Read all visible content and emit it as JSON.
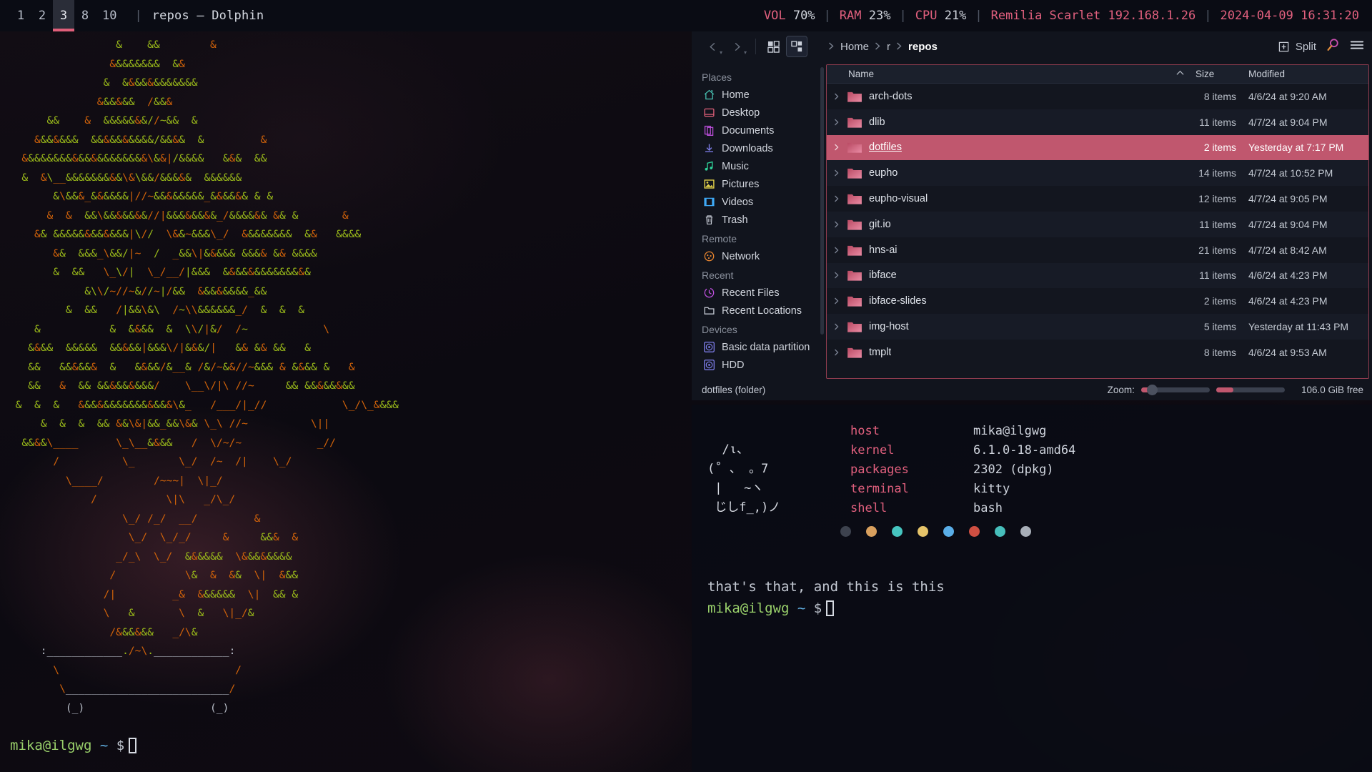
{
  "topbar": {
    "tags": [
      {
        "label": "1",
        "active": false
      },
      {
        "label": "2",
        "active": false
      },
      {
        "label": "3",
        "active": true
      },
      {
        "label": "8",
        "active": false
      },
      {
        "label": "10",
        "active": false
      }
    ],
    "separator": "|",
    "window_title": "repos — Dolphin",
    "status": {
      "vol_label": "VOL",
      "vol_value": "70%",
      "ram_label": "RAM",
      "ram_value": "23%",
      "cpu_label": "CPU",
      "cpu_value": "21%",
      "host_label": "Remilia Scarlet",
      "host_ip": "192.168.1.26",
      "datetime": "2024-04-09 16:31:20",
      "pipe": "|"
    },
    "accent": "#e05f7a"
  },
  "left_terminal": {
    "prompt_user": "mika@ilgwg",
    "prompt_path": "~",
    "prompt_symbol": "$",
    "ascii_art": [
      "                  &    &&        &",
      "                 &&&&&&&&  &&",
      "                &  &&&&&&&&&&&&",
      "               &&&&&&  /&&&",
      "       &&    &  &&&&&&&//~&&  &",
      "     &&&&&&&  &&&&&&&&&&/&&&&  &         &",
      "   &&&&&&&&&&&&&&&&&&&&\\&&|/&&&&   &&&  &&",
      "   &  &\\__&&&&&&&&&\\&\\&&/&&&&&  &&&&&&",
      "        &\\&&&_&&&&&&|//~&&&&&&&&_&&&&&& & &",
      "       &  &  &&\\&&&&&&&//|&&&&&&&&_/&&&&&& && &       &",
      "     && &&&&&&&&&&&&|\\//  \\&&~&&&\\_/  &&&&&&&&  &&   &&&&",
      "        &&  &&&_\\&&/|~  /  _&&\\|&&&&& &&&& && &&&&",
      "        &  &&   \\_\\/|  \\_/__/|&&&  &&&&&&&&&&&&&&",
      "             &\\\\/~//~&//~|/&&  &&&&&&&&_&&",
      "          &  &&   /|&&\\&\\  /~\\\\&&&&&&_/  &  &  &",
      "     &           &  &&&&  &  \\\\/|&/  /~            \\",
      "    &&&&  &&&&&  &&&&&|&&&\\/|&&&/|   && && &&   &",
      "    &&   &&&&&&  &   &&&&/&__& /&/~&&//~&&& & &&&& &   &",
      "    &&   &  && &&&&&&&&&/    \\__\\/|\\ //~     && &&&&&&&&",
      "  &  &  &   &&&&&&&&&&&&&&&\\&_   /___/|_//            \\_/\\_&&&&",
      "      &  &  &  && &&\\&|&&_&&\\&& \\_\\ //~          \\||",
      "   &&&&\\____      \\_\\__&&&&   /  \\/~/~            _//",
      "        /          \\_       \\_/  /~  /|    \\_/",
      "          \\____/        /~~~|  \\|_/",
      "              /           \\|\\   _/\\_/",
      "                   \\_/ /_/  __/         &",
      "                    \\_/  \\_/_/     &     &&&  &",
      "                  _/_\\  \\_/  &&&&&&  \\&&&&&&&&",
      "                 /           \\&  &  &&  \\|  &&&",
      "                /|         _&  &&&&&&  \\|  && &",
      "                \\   &       \\  &   \\|_/&",
      "                 /&&&&&&   _/\\&",
      "      :____________./~\\.____________:",
      "        \\                            /",
      "         \\__________________________/",
      "          (_)                    (_)"
    ]
  },
  "dolphin": {
    "toolbar": {
      "back_icon": "chevron-left-icon",
      "forward_icon": "chevron-right-icon",
      "view_icons_label": "icons-view",
      "view_details_label": "details-view",
      "split_label": "Split",
      "search_icon": "search-icon",
      "menu_icon": "hamburger-menu-icon"
    },
    "breadcrumb": [
      "Home",
      "r",
      "repos"
    ],
    "places": {
      "sections": [
        {
          "title": "Places",
          "items": [
            {
              "label": "Home",
              "icon": "home-icon",
              "color": "#49c4b5"
            },
            {
              "label": "Desktop",
              "icon": "desktop-icon",
              "color": "#e0607a"
            },
            {
              "label": "Documents",
              "icon": "documents-icon",
              "color": "#c050e0"
            },
            {
              "label": "Downloads",
              "icon": "download-icon",
              "color": "#7d7de8"
            },
            {
              "label": "Music",
              "icon": "music-icon",
              "color": "#2fd49a"
            },
            {
              "label": "Pictures",
              "icon": "pictures-icon",
              "color": "#e3d24a"
            },
            {
              "label": "Videos",
              "icon": "videos-icon",
              "color": "#3fa9f5"
            },
            {
              "label": "Trash",
              "icon": "trash-icon",
              "color": "#c3c8d2"
            }
          ]
        },
        {
          "title": "Remote",
          "items": [
            {
              "label": "Network",
              "icon": "network-icon",
              "color": "#e8852f"
            }
          ]
        },
        {
          "title": "Recent",
          "items": [
            {
              "label": "Recent Files",
              "icon": "recent-files-icon",
              "color": "#c050e0"
            },
            {
              "label": "Recent Locations",
              "icon": "recent-locations-icon",
              "color": "#c3c8d2"
            }
          ]
        },
        {
          "title": "Devices",
          "items": [
            {
              "label": "Basic data partition",
              "icon": "drive-icon",
              "color": "#7d7de8"
            },
            {
              "label": "HDD",
              "icon": "drive-icon",
              "color": "#7d7de8"
            }
          ]
        }
      ]
    },
    "columns": {
      "name": "Name",
      "size": "Size",
      "modified": "Modified",
      "sort_caret": "▲"
    },
    "files": [
      {
        "name": "arch-dots",
        "size": "8 items",
        "modified": "4/6/24 at 9:20 AM",
        "selected": false
      },
      {
        "name": "dlib",
        "size": "11 items",
        "modified": "4/7/24 at 9:04 PM",
        "selected": false
      },
      {
        "name": "dotfiles",
        "size": "2 items",
        "modified": "Yesterday at 7:17 PM",
        "selected": true
      },
      {
        "name": "eupho",
        "size": "14 items",
        "modified": "4/7/24 at 10:52 PM",
        "selected": false
      },
      {
        "name": "eupho-visual",
        "size": "12 items",
        "modified": "4/7/24 at 9:05 PM",
        "selected": false
      },
      {
        "name": "git.io",
        "size": "11 items",
        "modified": "4/7/24 at 9:04 PM",
        "selected": false
      },
      {
        "name": "hns-ai",
        "size": "21 items",
        "modified": "4/7/24 at 8:42 AM",
        "selected": false
      },
      {
        "name": "ibface",
        "size": "11 items",
        "modified": "4/6/24 at 4:23 PM",
        "selected": false
      },
      {
        "name": "ibface-slides",
        "size": "2 items",
        "modified": "4/6/24 at 4:23 PM",
        "selected": false
      },
      {
        "name": "img-host",
        "size": "5 items",
        "modified": "Yesterday at 11:43 PM",
        "selected": false
      },
      {
        "name": "tmplt",
        "size": "8 items",
        "modified": "4/6/24 at 9:53 AM",
        "selected": false
      }
    ],
    "statusbar": {
      "selection": "dotfiles (folder)",
      "zoom_label": "Zoom:",
      "free_space": "106.0 GiB free"
    },
    "selection_color": "#c0576e",
    "folder_color": "#d1607c"
  },
  "right_terminal": {
    "logo": [
      "  /ι、",
      "(˚ 、 。7",
      " |   ~ヽ",
      " じしf_,)ノ"
    ],
    "info": [
      {
        "key": "host",
        "value": "mika@ilgwg"
      },
      {
        "key": "kernel",
        "value": "6.1.0-18-amd64"
      },
      {
        "key": "packages",
        "value": "2302 (dpkg)"
      },
      {
        "key": "terminal",
        "value": "kitty"
      },
      {
        "key": "shell",
        "value": "bash"
      }
    ],
    "palette": [
      "#3d424e",
      "#d9a05e",
      "#46c5c0",
      "#e6c46a",
      "#5aaee8",
      "#cf4f42",
      "#47bfbc",
      "#a8aeb8"
    ],
    "output_line": "that's that, and this is this",
    "prompt_user": "mika@ilgwg",
    "prompt_path": "~",
    "prompt_symbol": "$"
  }
}
